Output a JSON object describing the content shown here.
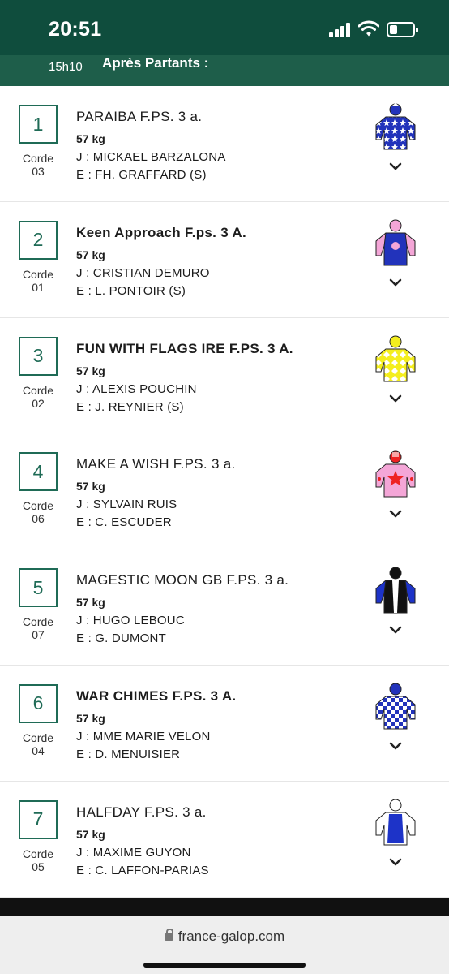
{
  "status_bar": {
    "time": "20:51"
  },
  "header": {
    "time": "15h10",
    "title": "Après Partants :"
  },
  "runners": [
    {
      "number": "1",
      "corde_label": "Corde",
      "corde": "03",
      "name": "PARAIBA F.PS. 3 a.",
      "bold": false,
      "weight": "57 kg",
      "jockey": "J : MICKAEL BARZALONA",
      "trainer": "E : FH. GRAFFARD (S)",
      "silk": "blue-white-stars-silk-icon"
    },
    {
      "number": "2",
      "corde_label": "Corde",
      "corde": "01",
      "name": "Keen Approach F.ps. 3 A.",
      "bold": true,
      "weight": "57 kg",
      "jockey": "J : CRISTIAN DEMURO",
      "trainer": "E : L. PONTOIR (S)",
      "silk": "blue-pink-sleeves-silk-icon"
    },
    {
      "number": "3",
      "corde_label": "Corde",
      "corde": "02",
      "name": "FUN WITH FLAGS IRE F.PS. 3 A.",
      "bold": true,
      "weight": "57 kg",
      "jockey": "J : ALEXIS POUCHIN",
      "trainer": "E : J. REYNIER (S)",
      "silk": "yellow-white-diamonds-silk-icon"
    },
    {
      "number": "4",
      "corde_label": "Corde",
      "corde": "06",
      "name": "MAKE A WISH F.PS. 3 a.",
      "bold": false,
      "weight": "57 kg",
      "jockey": "J : SYLVAIN RUIS",
      "trainer": "E : C. ESCUDER",
      "silk": "pink-red-star-silk-icon"
    },
    {
      "number": "5",
      "corde_label": "Corde",
      "corde": "07",
      "name": "MAGESTIC MOON GB F.PS. 3 a.",
      "bold": false,
      "weight": "57 kg",
      "jockey": "J : HUGO LEBOUC",
      "trainer": "E : G. DUMONT",
      "silk": "black-white-blue-sleeves-silk-icon"
    },
    {
      "number": "6",
      "corde_label": "Corde",
      "corde": "04",
      "name": "WAR CHIMES F.PS. 3 A.",
      "bold": true,
      "weight": "57 kg",
      "jockey": "J : MME MARIE VELON",
      "trainer": "E : D. MENUISIER",
      "silk": "blue-white-check-silk-icon"
    },
    {
      "number": "7",
      "corde_label": "Corde",
      "corde": "05",
      "name": "HALFDAY F.PS. 3 a.",
      "bold": false,
      "weight": "57 kg",
      "jockey": "J : MAXIME GUYON",
      "trainer": "E : C. LAFFON-PARIAS",
      "silk": "white-blue-panel-silk-icon"
    }
  ],
  "browser": {
    "url": "france-galop.com"
  },
  "colors": {
    "header_bg": "#0f4d3d",
    "subheader_bg": "#1e5e4a",
    "accent": "#1f6b56"
  }
}
